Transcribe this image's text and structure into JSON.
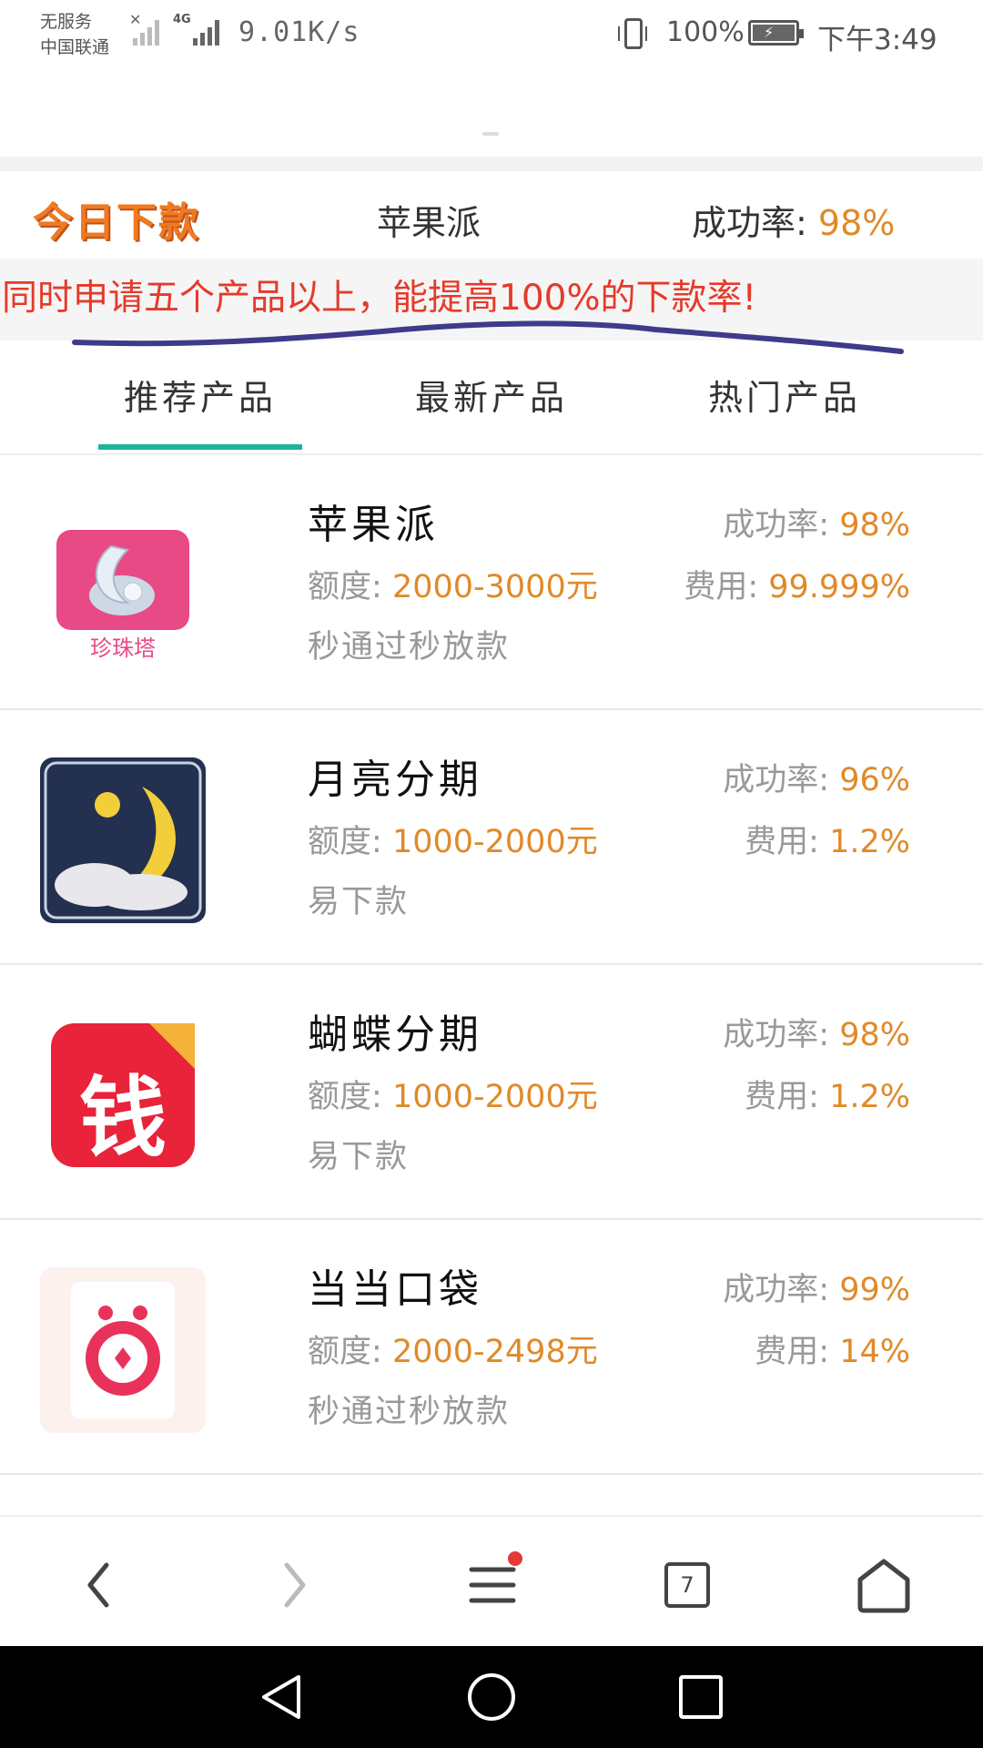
{
  "status_bar": {
    "carrier_line1": "无服务",
    "carrier_line2": "中国联通",
    "net_type": "4G",
    "net_speed": "9.01K/s",
    "battery_percent": "100%",
    "time": "下午3:49"
  },
  "summary": {
    "logo_text": "今日下款",
    "product_name": "苹果派",
    "rate_label": "成功率:",
    "rate_value": "98%"
  },
  "notice": {
    "text": "同时申请五个产品以上，能提高100%的下款率!"
  },
  "tabs": [
    {
      "label": "推荐产品",
      "active": true
    },
    {
      "label": "最新产品",
      "active": false
    },
    {
      "label": "热门产品",
      "active": false
    }
  ],
  "labels": {
    "rate": "成功率:",
    "amount": "额度:",
    "fee": "费用:"
  },
  "products": [
    {
      "name": "苹果派",
      "rate": "98%",
      "amount": "2000-3000元",
      "fee": "99.999%",
      "desc": "秒通过秒放款",
      "logo_text": "珍珠塔",
      "logo_icon": "pearl-shell-icon"
    },
    {
      "name": "月亮分期",
      "rate": "96%",
      "amount": "1000-2000元",
      "fee": "1.2%",
      "desc": "易下款",
      "logo_icon": "moon-icon"
    },
    {
      "name": "蝴蝶分期",
      "rate": "98%",
      "amount": "1000-2000元",
      "fee": "1.2%",
      "desc": "易下款",
      "logo_text": "钱",
      "logo_icon": "money-icon"
    },
    {
      "name": "当当口袋",
      "rate": "99%",
      "amount": "2000-2498元",
      "fee": "14%",
      "desc": "秒通过秒放款",
      "logo_icon": "piggy-icon"
    }
  ],
  "toolbar": {
    "tabs_count": "7"
  },
  "colors": {
    "accent": "#1fb39c",
    "value_orange": "#e08a2a",
    "notice_red": "#e53a2a"
  }
}
